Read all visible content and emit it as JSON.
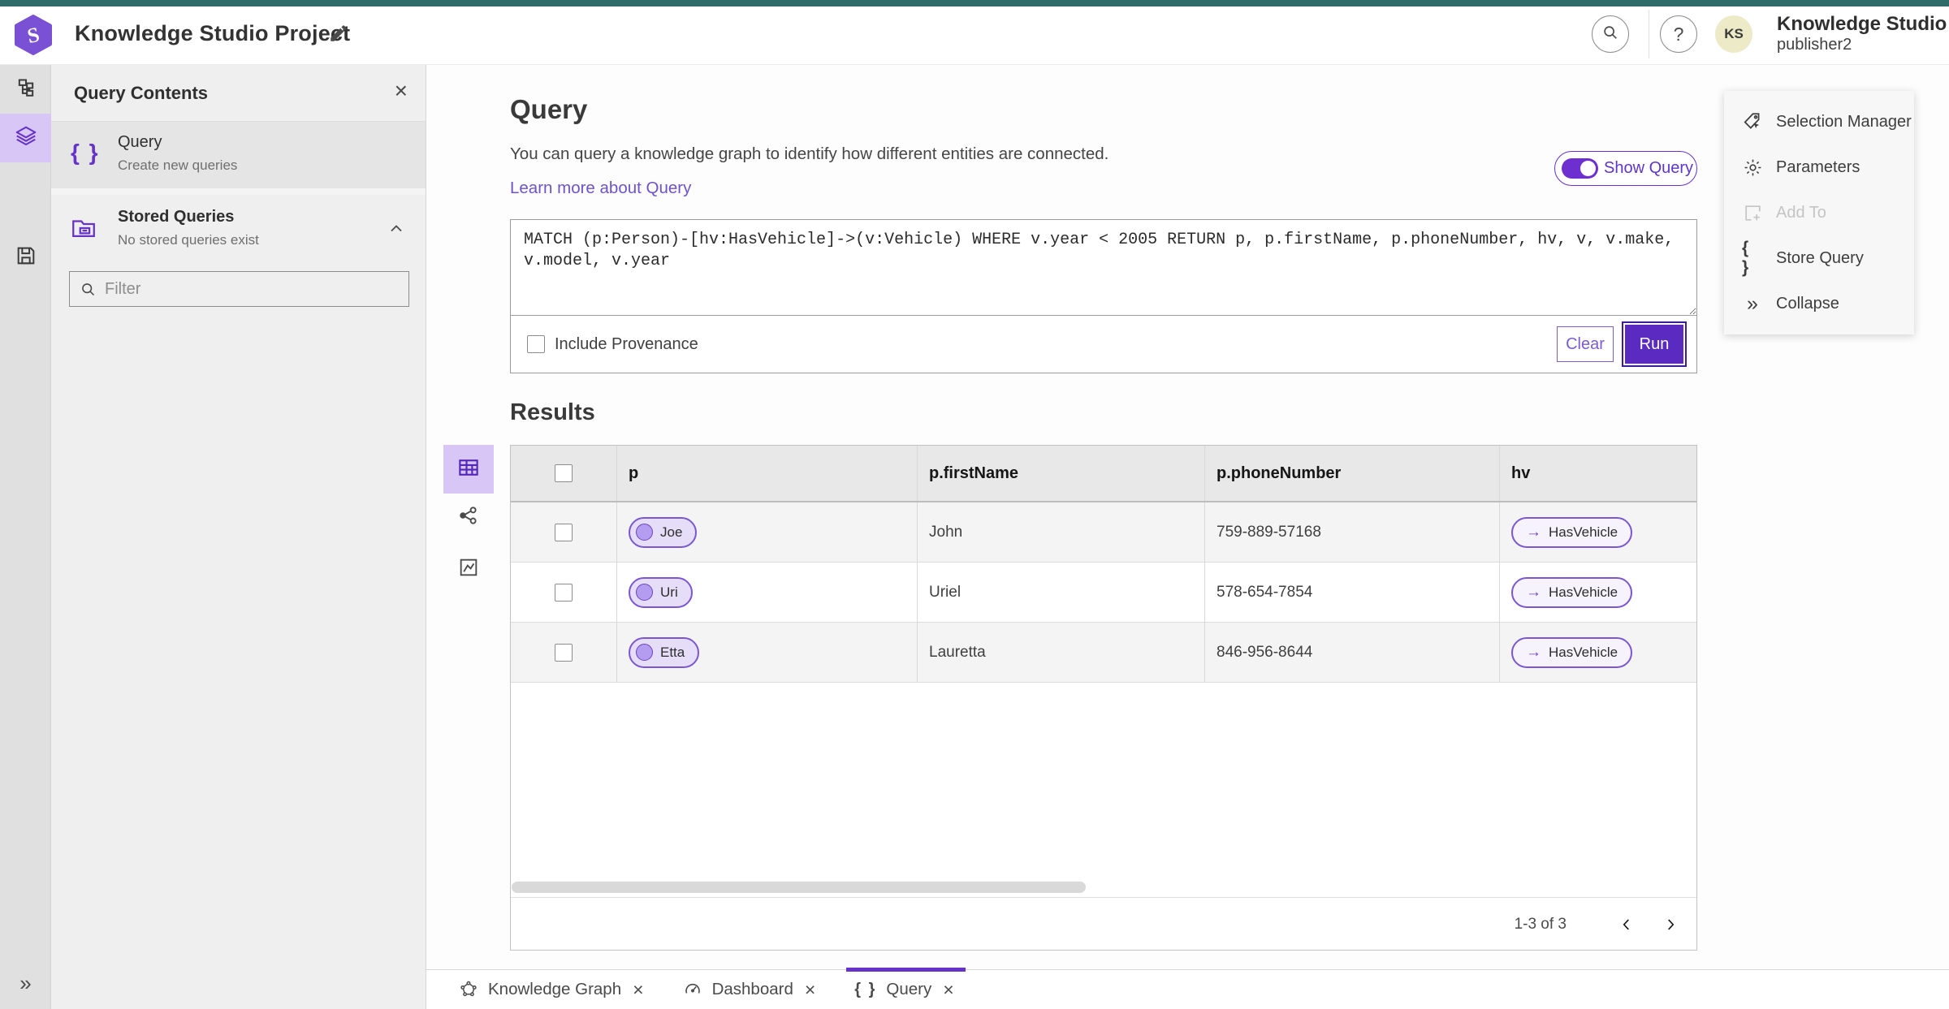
{
  "topbar": {
    "title": "Knowledge Studio Project",
    "user_initials": "KS",
    "user_name": "Knowledge Studio",
    "user_role": "publisher2"
  },
  "query_contents": {
    "title": "Query Contents",
    "query_item": {
      "title": "Query",
      "subtitle": "Create new queries"
    },
    "stored_queries": {
      "title": "Stored Queries",
      "subtitle": "No stored queries exist"
    },
    "filter_placeholder": "Filter"
  },
  "query_panel": {
    "heading": "Query",
    "description": "You can query a knowledge graph to identify how different entities are connected.",
    "learn_more": "Learn more about Query",
    "show_query_label": "Show Query",
    "show_query_on": true,
    "query_text": "MATCH (p:Person)-[hv:HasVehicle]->(v:Vehicle) WHERE v.year < 2005 RETURN p, p.firstName, p.phoneNumber, hv, v, v.make, v.model, v.year",
    "include_provenance_label": "Include Provenance",
    "clear_label": "Clear",
    "run_label": "Run"
  },
  "results": {
    "heading": "Results",
    "columns": [
      "p",
      "p.firstName",
      "p.phoneNumber",
      "hv"
    ],
    "rows": [
      {
        "p": "Joe",
        "firstName": "John",
        "phoneNumber": "759-889-57168",
        "hv": "HasVehicle"
      },
      {
        "p": "Uri",
        "firstName": "Uriel",
        "phoneNumber": "578-654-7854",
        "hv": "HasVehicle"
      },
      {
        "p": "Etta",
        "firstName": "Lauretta",
        "phoneNumber": "846-956-8644",
        "hv": "HasVehicle"
      }
    ],
    "pagination": "1-3 of 3"
  },
  "action_panel": {
    "items": [
      {
        "label": "Selection Manager",
        "disabled": false
      },
      {
        "label": "Parameters",
        "disabled": false
      },
      {
        "label": "Add To",
        "disabled": true
      },
      {
        "label": "Store Query",
        "disabled": false
      },
      {
        "label": "Collapse",
        "disabled": false
      }
    ]
  },
  "tabs": [
    {
      "label": "Knowledge Graph",
      "active": false
    },
    {
      "label": "Dashboard",
      "active": false
    },
    {
      "label": "Query",
      "active": true
    }
  ],
  "icons": {
    "close": "×",
    "braces": "{ }",
    "arrow_right": "→",
    "question": "?",
    "collapse": "»",
    "chevron_left": "‹",
    "chevron_right": "›"
  },
  "colors": {
    "teal_bar": "#2e6b69",
    "accent": "#6632c8",
    "accent_dark": "#5b2ac0",
    "rail_selected": "#d7c6f6",
    "pill_fill": "#e6def8",
    "link": "#6d53c8"
  }
}
